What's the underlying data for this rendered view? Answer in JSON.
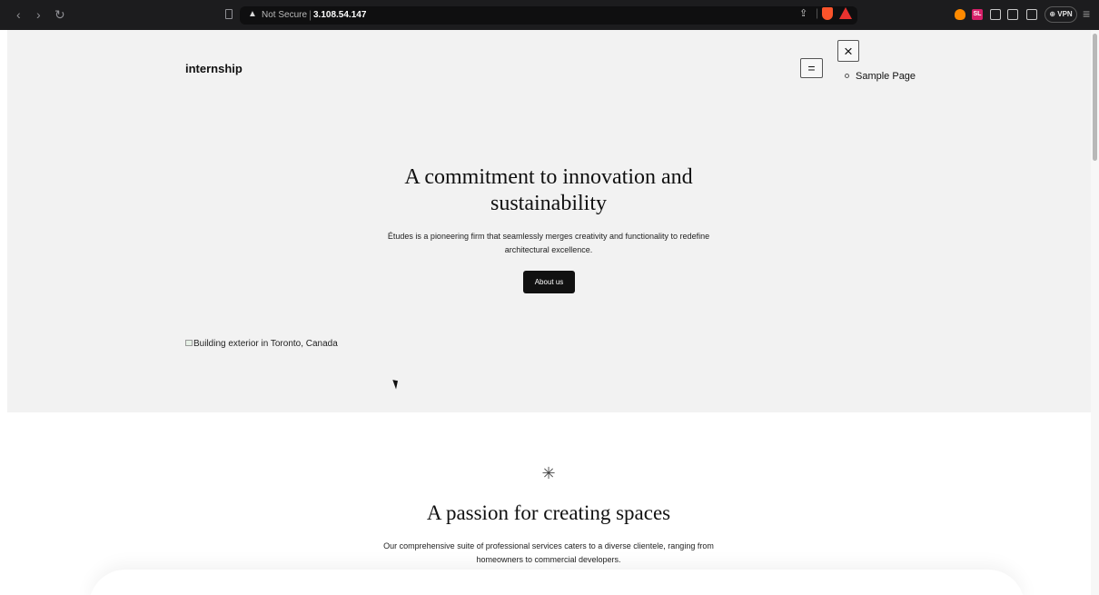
{
  "browser": {
    "nav": {
      "back_icon": "‹",
      "forward_icon": "›",
      "reload_icon": "↻"
    },
    "url_bar": {
      "warning_icon": "▲",
      "security_label": "Not Secure",
      "separator": "|",
      "host": "3.108.54.147"
    },
    "extensions": {
      "sl_label": "SL",
      "vpn_label": "⊕ VPN"
    },
    "menu_icon": "≡",
    "brave_sep": "|",
    "share_icon": "⇪",
    "colors": {
      "chrome_bg": "#1c1c1e",
      "brave_orange": "#fb542b",
      "rewards_red": "#e8322f",
      "sl_pink": "#d61f69"
    }
  },
  "header": {
    "site_title": "internship",
    "menu_open_icon": "=",
    "menu_close_icon": "×",
    "nav_items": [
      {
        "label": "Sample Page"
      }
    ]
  },
  "hero": {
    "heading": "A commitment to innovation and sustainability",
    "text": "Études is a pioneering firm that seamlessly merges creativity and functionality to redefine architectural excellence.",
    "button_label": "About us",
    "image_alt": "Building exterior in Toronto, Canada",
    "colors": {
      "background": "#f2f2f2",
      "button_bg": "#111111"
    }
  },
  "services": {
    "icon": "✳",
    "heading": "A passion for creating spaces",
    "text": "Our comprehensive suite of professional services caters to a diverse clientele, ranging from homeowners to commercial developers."
  }
}
